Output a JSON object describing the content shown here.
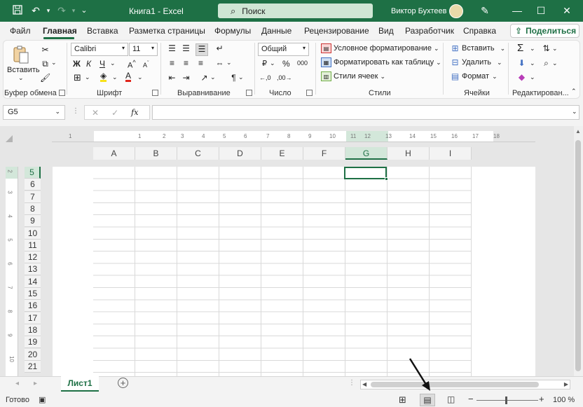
{
  "titlebar": {
    "doc_title": "Книга1  -  Excel",
    "search_placeholder": "Поиск",
    "user_name": "Виктор Бухтеев"
  },
  "tabs": [
    "Файл",
    "Главная",
    "Вставка",
    "Разметка страницы",
    "Формулы",
    "Данные",
    "Рецензирование",
    "Вид",
    "Разработчик",
    "Справка"
  ],
  "active_tab": "Главная",
  "share_label": "Поделиться",
  "ribbon": {
    "clipboard": {
      "paste": "Вставить",
      "label": "Буфер обмена"
    },
    "font": {
      "name": "Calibri",
      "size": "11",
      "bold": "Ж",
      "italic": "К",
      "underline": "Ч",
      "label": "Шрифт"
    },
    "alignment": {
      "label": "Выравнивание"
    },
    "number": {
      "format": "Общий",
      "label": "Число"
    },
    "styles": {
      "conditional": "Условное форматирование",
      "as_table": "Форматировать как таблицу",
      "cell_styles": "Стили ячеек",
      "label": "Стили"
    },
    "cells": {
      "insert": "Вставить",
      "delete": "Удалить",
      "format": "Формат",
      "label": "Ячейки"
    },
    "editing": {
      "label": "Редактирован..."
    }
  },
  "formula_bar": {
    "name_box": "G5",
    "value": ""
  },
  "ruler_numbers": [
    "1",
    "1",
    "2",
    "3",
    "4",
    "5",
    "6",
    "7",
    "8",
    "9",
    "10",
    "11",
    "12",
    "13",
    "14",
    "15",
    "16",
    "17",
    "18"
  ],
  "columns": [
    "A",
    "B",
    "C",
    "D",
    "E",
    "F",
    "G",
    "H",
    "I"
  ],
  "selected_column": "G",
  "rows": [
    "5",
    "6",
    "7",
    "8",
    "9",
    "10",
    "11",
    "12",
    "13",
    "14",
    "15",
    "16",
    "17",
    "18",
    "19",
    "20",
    "21"
  ],
  "selected_row": "5",
  "vruler_numbers": [
    "2",
    "3",
    "4",
    "5",
    "6",
    "7",
    "8",
    "9",
    "10"
  ],
  "sheet_tabs": [
    "Лист1"
  ],
  "status": {
    "ready": "Готово",
    "zoom": "100 %"
  },
  "colors": {
    "accent": "#1e7045"
  }
}
